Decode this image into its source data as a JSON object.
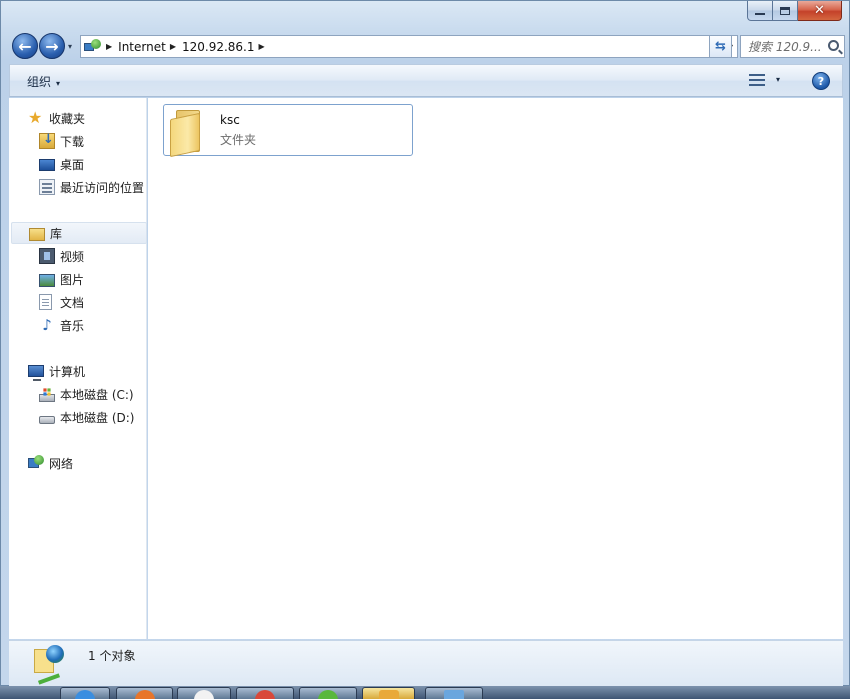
{
  "window": {
    "caption_buttons": {
      "minimize": "minimize-icon",
      "maximize": "maximize-icon",
      "close": "✕"
    }
  },
  "navigation": {
    "back_glyph": "←",
    "forward_glyph": "→",
    "recent_dropdown_glyph": "▾",
    "address": {
      "icon": "network-globe-icon",
      "separator": "▶",
      "breadcrumbs": [
        "Internet",
        "120.92.86.1"
      ],
      "dropdown_glyph": "▾"
    },
    "refresh_glyph": "⇆",
    "search_placeholder": "搜索 120.9..."
  },
  "command_bar": {
    "organize_label": "组织",
    "organize_arrow": "▾",
    "views_arrow": "▾",
    "help_label": "?"
  },
  "sidebar": {
    "favorites": {
      "label": "收藏夹",
      "icon": "star-icon",
      "star": "★"
    },
    "favorite_items": [
      {
        "label": "下载",
        "icon": "download-icon"
      },
      {
        "label": "桌面",
        "icon": "desktop-icon"
      },
      {
        "label": "最近访问的位置",
        "icon": "recent-places-icon"
      }
    ],
    "libraries": {
      "label": "库",
      "icon": "library-icon"
    },
    "library_items": [
      {
        "label": "视频",
        "icon": "video-icon"
      },
      {
        "label": "图片",
        "icon": "picture-icon"
      },
      {
        "label": "文档",
        "icon": "document-icon"
      },
      {
        "label": "音乐",
        "icon": "music-icon",
        "glyph": "♪"
      }
    ],
    "computer": {
      "label": "计算机",
      "icon": "computer-icon"
    },
    "computer_items": [
      {
        "label": "本地磁盘 (C:)",
        "icon": "drive-c-icon"
      },
      {
        "label": "本地磁盘 (D:)",
        "icon": "drive-d-icon"
      }
    ],
    "network": {
      "label": "网络",
      "icon": "network-icon"
    }
  },
  "content": {
    "items": [
      {
        "name": "ksc",
        "type": "文件夹",
        "icon": "folder-icon"
      }
    ]
  },
  "details": {
    "summary": "1 个对象"
  },
  "colors": {
    "accent": "#2f6bb5",
    "selection_border": "#7da2ce",
    "close_button": "#c4412a"
  }
}
